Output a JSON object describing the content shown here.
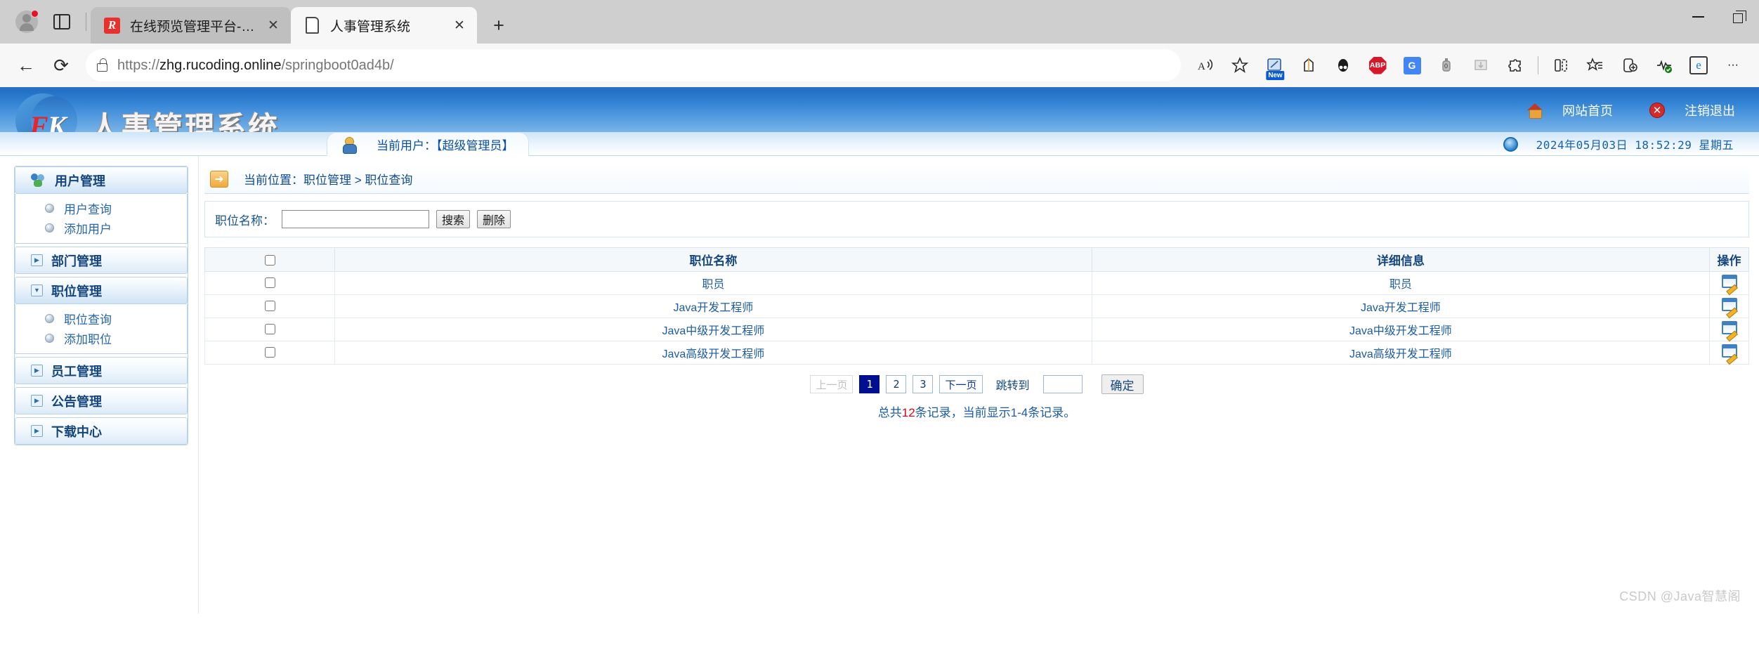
{
  "browser": {
    "tabs": [
      {
        "title": "在线预览管理平台-Java智慧阁",
        "favicon": "red-logo-icon",
        "active": false
      },
      {
        "title": "人事管理系统",
        "favicon": "document-icon",
        "active": true
      }
    ],
    "new_tab_label": "+",
    "close_label": "✕",
    "nav": {
      "back": "←",
      "reload": "⟳"
    },
    "url": {
      "scheme": "https://",
      "host": "zhg.rucoding.online",
      "path": "/springboot0ad4b/"
    },
    "url_full": "https://zhg.rucoding.online/springboot0ad4b/",
    "toolbar_icons": [
      "read-aloud-icon",
      "favorite-star-icon",
      "collections-new-icon",
      "shopping-bag-icon",
      "dark-reader-icon",
      "adblock-plus-icon",
      "google-translate-icon",
      "extension-tool-icon",
      "download-extension-icon",
      "extensions-puzzle-icon",
      "split-screen-icon",
      "favorites-list-icon",
      "add-device-icon",
      "browser-essentials-icon",
      "internet-explorer-mode-icon",
      "settings-more-icon"
    ],
    "window_controls": [
      "minimize",
      "restore"
    ],
    "extension_badge": "New",
    "adblock_label": "ABP",
    "translate_label": "G",
    "ie_label": "e",
    "more_label": "···"
  },
  "header": {
    "logo_f": "F",
    "logo_k": "K",
    "title": "人事管理系统",
    "links": [
      {
        "label": "网站首页",
        "icon": "home-icon"
      },
      {
        "label": "注销退出",
        "icon": "logout-close-icon"
      }
    ],
    "current_user": "当前用户：【超级管理员】",
    "datetime": "2024年05月03日 18:52:29 星期五"
  },
  "sidebar": {
    "groups": [
      {
        "label": "用户管理",
        "icon": "users-group-icon",
        "expanded": true,
        "items": [
          {
            "label": "用户查询"
          },
          {
            "label": "添加用户"
          }
        ]
      },
      {
        "label": "部门管理",
        "icon": "expand-right-icon",
        "expanded": false,
        "items": []
      },
      {
        "label": "职位管理",
        "icon": "expand-down-icon",
        "expanded": true,
        "items": [
          {
            "label": "职位查询"
          },
          {
            "label": "添加职位"
          }
        ]
      },
      {
        "label": "员工管理",
        "icon": "expand-right-icon",
        "expanded": false,
        "items": []
      },
      {
        "label": "公告管理",
        "icon": "expand-right-icon",
        "expanded": false,
        "items": []
      },
      {
        "label": "下载中心",
        "icon": "expand-right-icon",
        "expanded": false,
        "items": []
      }
    ],
    "expander_right": "▶",
    "expander_down": "▼"
  },
  "main": {
    "breadcrumb": "当前位置：职位管理 > 职位查询",
    "breadcrumb_icon": "arrow-right-icon",
    "search": {
      "label": "职位名称：",
      "value": "",
      "placeholder": "",
      "search_button": "搜索",
      "delete_button": "删除"
    },
    "table": {
      "headers": [
        "",
        "职位名称",
        "详细信息",
        "操作"
      ],
      "rows": [
        {
          "checked": false,
          "name": "职员",
          "info": "职员",
          "action": "edit-icon"
        },
        {
          "checked": false,
          "name": "Java开发工程师",
          "info": "Java开发工程师",
          "action": "edit-icon"
        },
        {
          "checked": false,
          "name": "Java中级开发工程师",
          "info": "Java中级开发工程师",
          "action": "edit-icon"
        },
        {
          "checked": false,
          "name": "Java高级开发工程师",
          "info": "Java高级开发工程师",
          "action": "edit-icon"
        }
      ]
    },
    "pagination": {
      "prev": "上一页",
      "pages": [
        "1",
        "2",
        "3"
      ],
      "active_page": "1",
      "next": "下一页",
      "jump_label": "跳转到",
      "jump_value": "",
      "confirm": "确定"
    },
    "summary": {
      "prefix": "总共",
      "total": "12",
      "suffix": "条记录，当前显示1-4条记录。"
    }
  },
  "watermark": "CSDN @Java智慧阁",
  "colors": {
    "header_blue": "#2c6fc4",
    "link_blue": "#1d5ba5",
    "active_page": "#000f8f",
    "count_red": "#e60012"
  }
}
